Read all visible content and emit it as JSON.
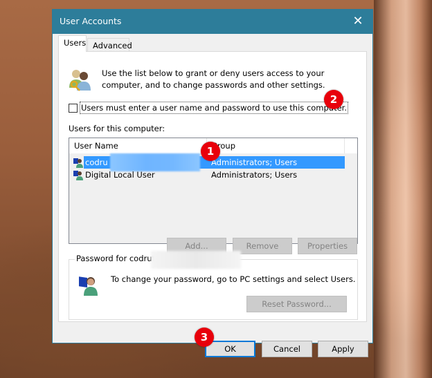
{
  "window": {
    "title": "User Accounts",
    "close_label": "✕"
  },
  "tabs": [
    {
      "label": "Users",
      "active": true
    },
    {
      "label": "Advanced",
      "active": false
    }
  ],
  "intro_text": "Use the list below to grant or deny users access to your computer, and to change passwords and other settings.",
  "require_login": {
    "label": "Users must enter a user name and password to use this computer.",
    "checked": false
  },
  "users_list": {
    "label": "Users for this computer:",
    "columns": [
      "User Name",
      "Group"
    ],
    "rows": [
      {
        "name": "codru",
        "group": "Administrators; Users",
        "selected": true,
        "name_redacted": true
      },
      {
        "name": "Digital Local User",
        "group": "Administrators; Users",
        "selected": false
      }
    ]
  },
  "list_buttons": {
    "add": "Add...",
    "remove": "Remove",
    "properties": "Properties"
  },
  "password_group": {
    "legend": "Password for codrut",
    "text": "To change your password, go to PC settings and select Users.",
    "reset_button": "Reset Password..."
  },
  "dialog_buttons": {
    "ok": "OK",
    "cancel": "Cancel",
    "apply": "Apply"
  },
  "annotations": [
    {
      "number": "1",
      "target": "selected user row"
    },
    {
      "number": "2",
      "target": "require login checkbox"
    },
    {
      "number": "3",
      "target": "OK button"
    }
  ],
  "colors": {
    "titlebar": "#2d7d9a",
    "selection": "#3399ff",
    "marker": "#e8000b",
    "default_button_border": "#0078d7"
  }
}
